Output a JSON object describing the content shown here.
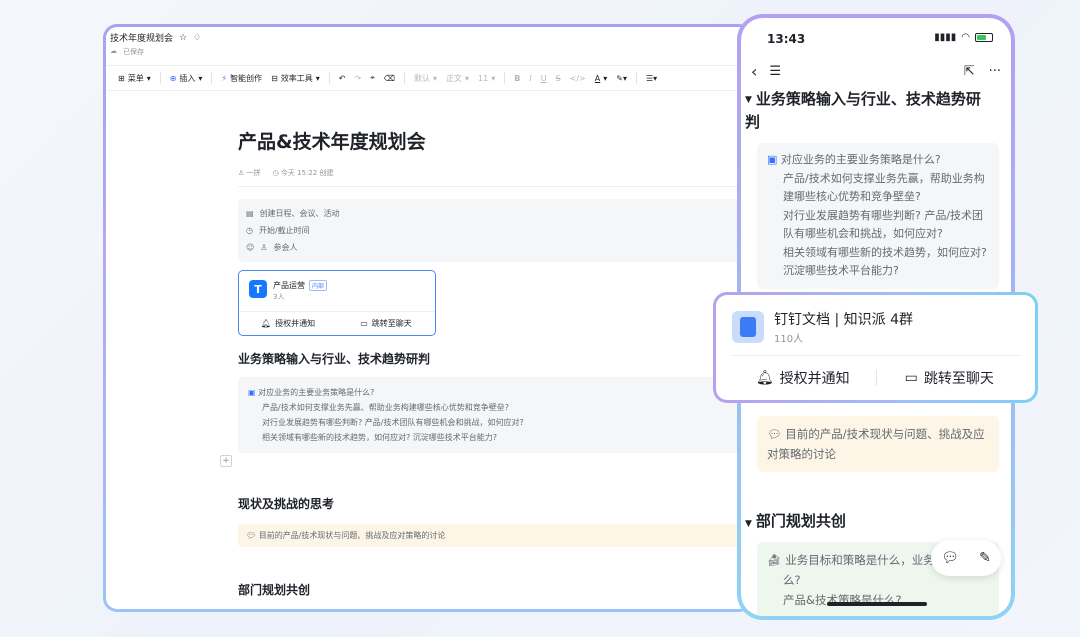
{
  "desktop": {
    "doc_tab_title": "技术年度规划会",
    "saved_status": "已保存",
    "toolbar": {
      "menu": "菜单",
      "insert": "插入",
      "ai_create": "智能创作",
      "efficiency": "效率工具",
      "style_default": "默认",
      "font_body": "正文",
      "font_size": "11"
    },
    "title": "产品&技术年度规划会",
    "author": "一拼",
    "created": "今天 15:22 创建",
    "schedule": {
      "create": "创建日程、会议、活动",
      "time": "开始/截止时间",
      "attendees": "参会人"
    },
    "group_card": {
      "name": "产品运营",
      "tag": "内部",
      "count": "3人",
      "authorize": "授权并通知",
      "jump": "跳转至聊天"
    },
    "section1": "业务策略输入与行业、技术趋势研判",
    "questions": [
      "对应业务的主要业务策略是什么?",
      "产品/技术如何支撑业务先赢、帮助业务构建哪些核心优势和竞争壁垒?",
      "对行业发展趋势有哪些判断? 产品/技术团队有哪些机会和挑战，如何应对?",
      "相关领域有哪些新的技术趋势，如何应对? 沉淀哪些技术平台能力?"
    ],
    "section2": "现状及挑战的思考",
    "status_note": "目前的产品/技术现状与问题、挑战及应对策略的讨论",
    "section3": "部门规划共创"
  },
  "phone": {
    "time": "13:43",
    "section1": "业务策略输入与行业、技术趋势研判",
    "questions": [
      "对应业务的主要业务策略是什么?",
      "产品/技术如何支撑业务先赢，帮助业务构建哪些核心优势和竞争壁垒?",
      "对行业发展趋势有哪些判断? 产品/技术团队有哪些机会和挑战，如何应对?",
      "相关领域有哪些新的技术趋势，如何应对? 沉淀哪些技术平台能力?"
    ],
    "status_note": "目前的产品/技术现状与问题、挑战及应对策略的讨论",
    "section3": "部门规划共创",
    "goal_q1": "业务目标和策略是什么，业务",
    "goal_q1b": "么?",
    "goal_q2": "产品&技术策略是什么?"
  },
  "float_card": {
    "name": "钉钉文档 | 知识派 4群",
    "count": "110人",
    "authorize": "授权并通知",
    "jump": "跳转至聊天"
  }
}
